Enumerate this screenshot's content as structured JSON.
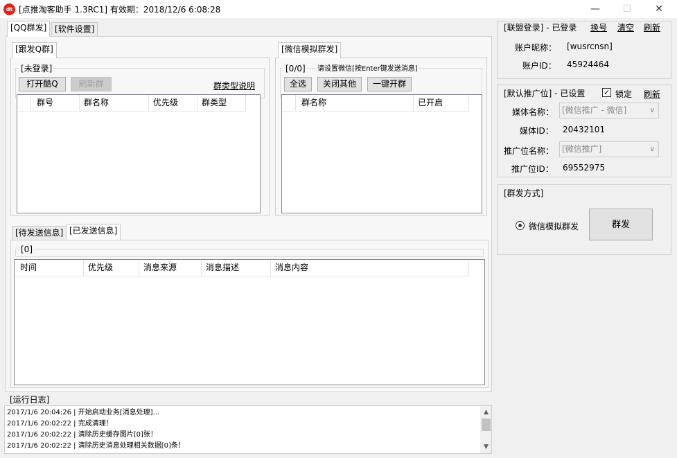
{
  "window": {
    "title": "[点推淘客助手 1.3RC1] 有效期：2018/12/6 6:08:28",
    "icon_text": "dt",
    "minimize": "—",
    "maximize": "☐",
    "close": "✕"
  },
  "main_tabs": [
    {
      "label": "[QQ群发]"
    },
    {
      "label": "[软件设置]"
    }
  ],
  "qq_panel": {
    "tab": "[跟发Q群]",
    "status_group": "[未登录]",
    "open_button": "打开酷Q",
    "refresh_button": "刷新群",
    "type_link": "群类型说明",
    "columns": [
      "群号",
      "群名称",
      "优先级",
      "群类型"
    ]
  },
  "wechat_panel": {
    "tab": "[微信模拟群发]",
    "count": "[0/0]",
    "hint": "请设置微信[按Enter键发送消息]",
    "select_all": "全选",
    "close_others": "关闭其他",
    "open_all": "一键开群",
    "columns": [
      "群名称",
      "已开启"
    ]
  },
  "message_tabs": [
    {
      "label": "[待发送信息]"
    },
    {
      "label": "[已发送信息]"
    }
  ],
  "message_panel": {
    "count": "[0]",
    "columns": [
      "时间",
      "优先级",
      "消息来源",
      "消息描述",
      "消息内容"
    ]
  },
  "log": {
    "title": "[运行日志]",
    "lines": [
      "2017/1/6 20:04:26 | 开始启动业务[消息处理]...",
      "2017/1/6 20:02:22 | 完成清理！",
      "2017/1/6 20:02:22 | 清除历史缓存图片[0]张！",
      "2017/1/6 20:02:22 | 清除历史消息处理相关数据[0]条！"
    ],
    "scroll_up": "▲",
    "scroll_down": "▼"
  },
  "alliance": {
    "title": "[联盟登录] - 已登录",
    "switch_link": "换号",
    "clear_link": "清空",
    "refresh_link": "刷新",
    "nickname_label": "账户昵称：",
    "nickname_value": "[wusrcnsn]",
    "account_label": "账户ID：",
    "account_value": "45924464"
  },
  "promo": {
    "title": "[默认推广位] - 已设置",
    "lock_label": "锁定",
    "lock_checked": "✓",
    "refresh_link": "刷新",
    "media_name_label": "媒体名称：",
    "media_name_value": "[微信推广 - 微信]",
    "media_id_label": "媒体ID：",
    "media_id_value": "20432101",
    "slot_name_label": "推广位名称：",
    "slot_name_value": "[微信推广]",
    "slot_id_label": "推广位ID：",
    "slot_id_value": "69552975",
    "dropdown_arrow": "∨"
  },
  "send_mode": {
    "title": "[群发方式]",
    "radio_label": "微信模拟群发",
    "send_button": "群发"
  },
  "colors": {
    "desktop": "#1e6cc8",
    "window": "#f0f0f0",
    "icon": "#e0241b"
  }
}
